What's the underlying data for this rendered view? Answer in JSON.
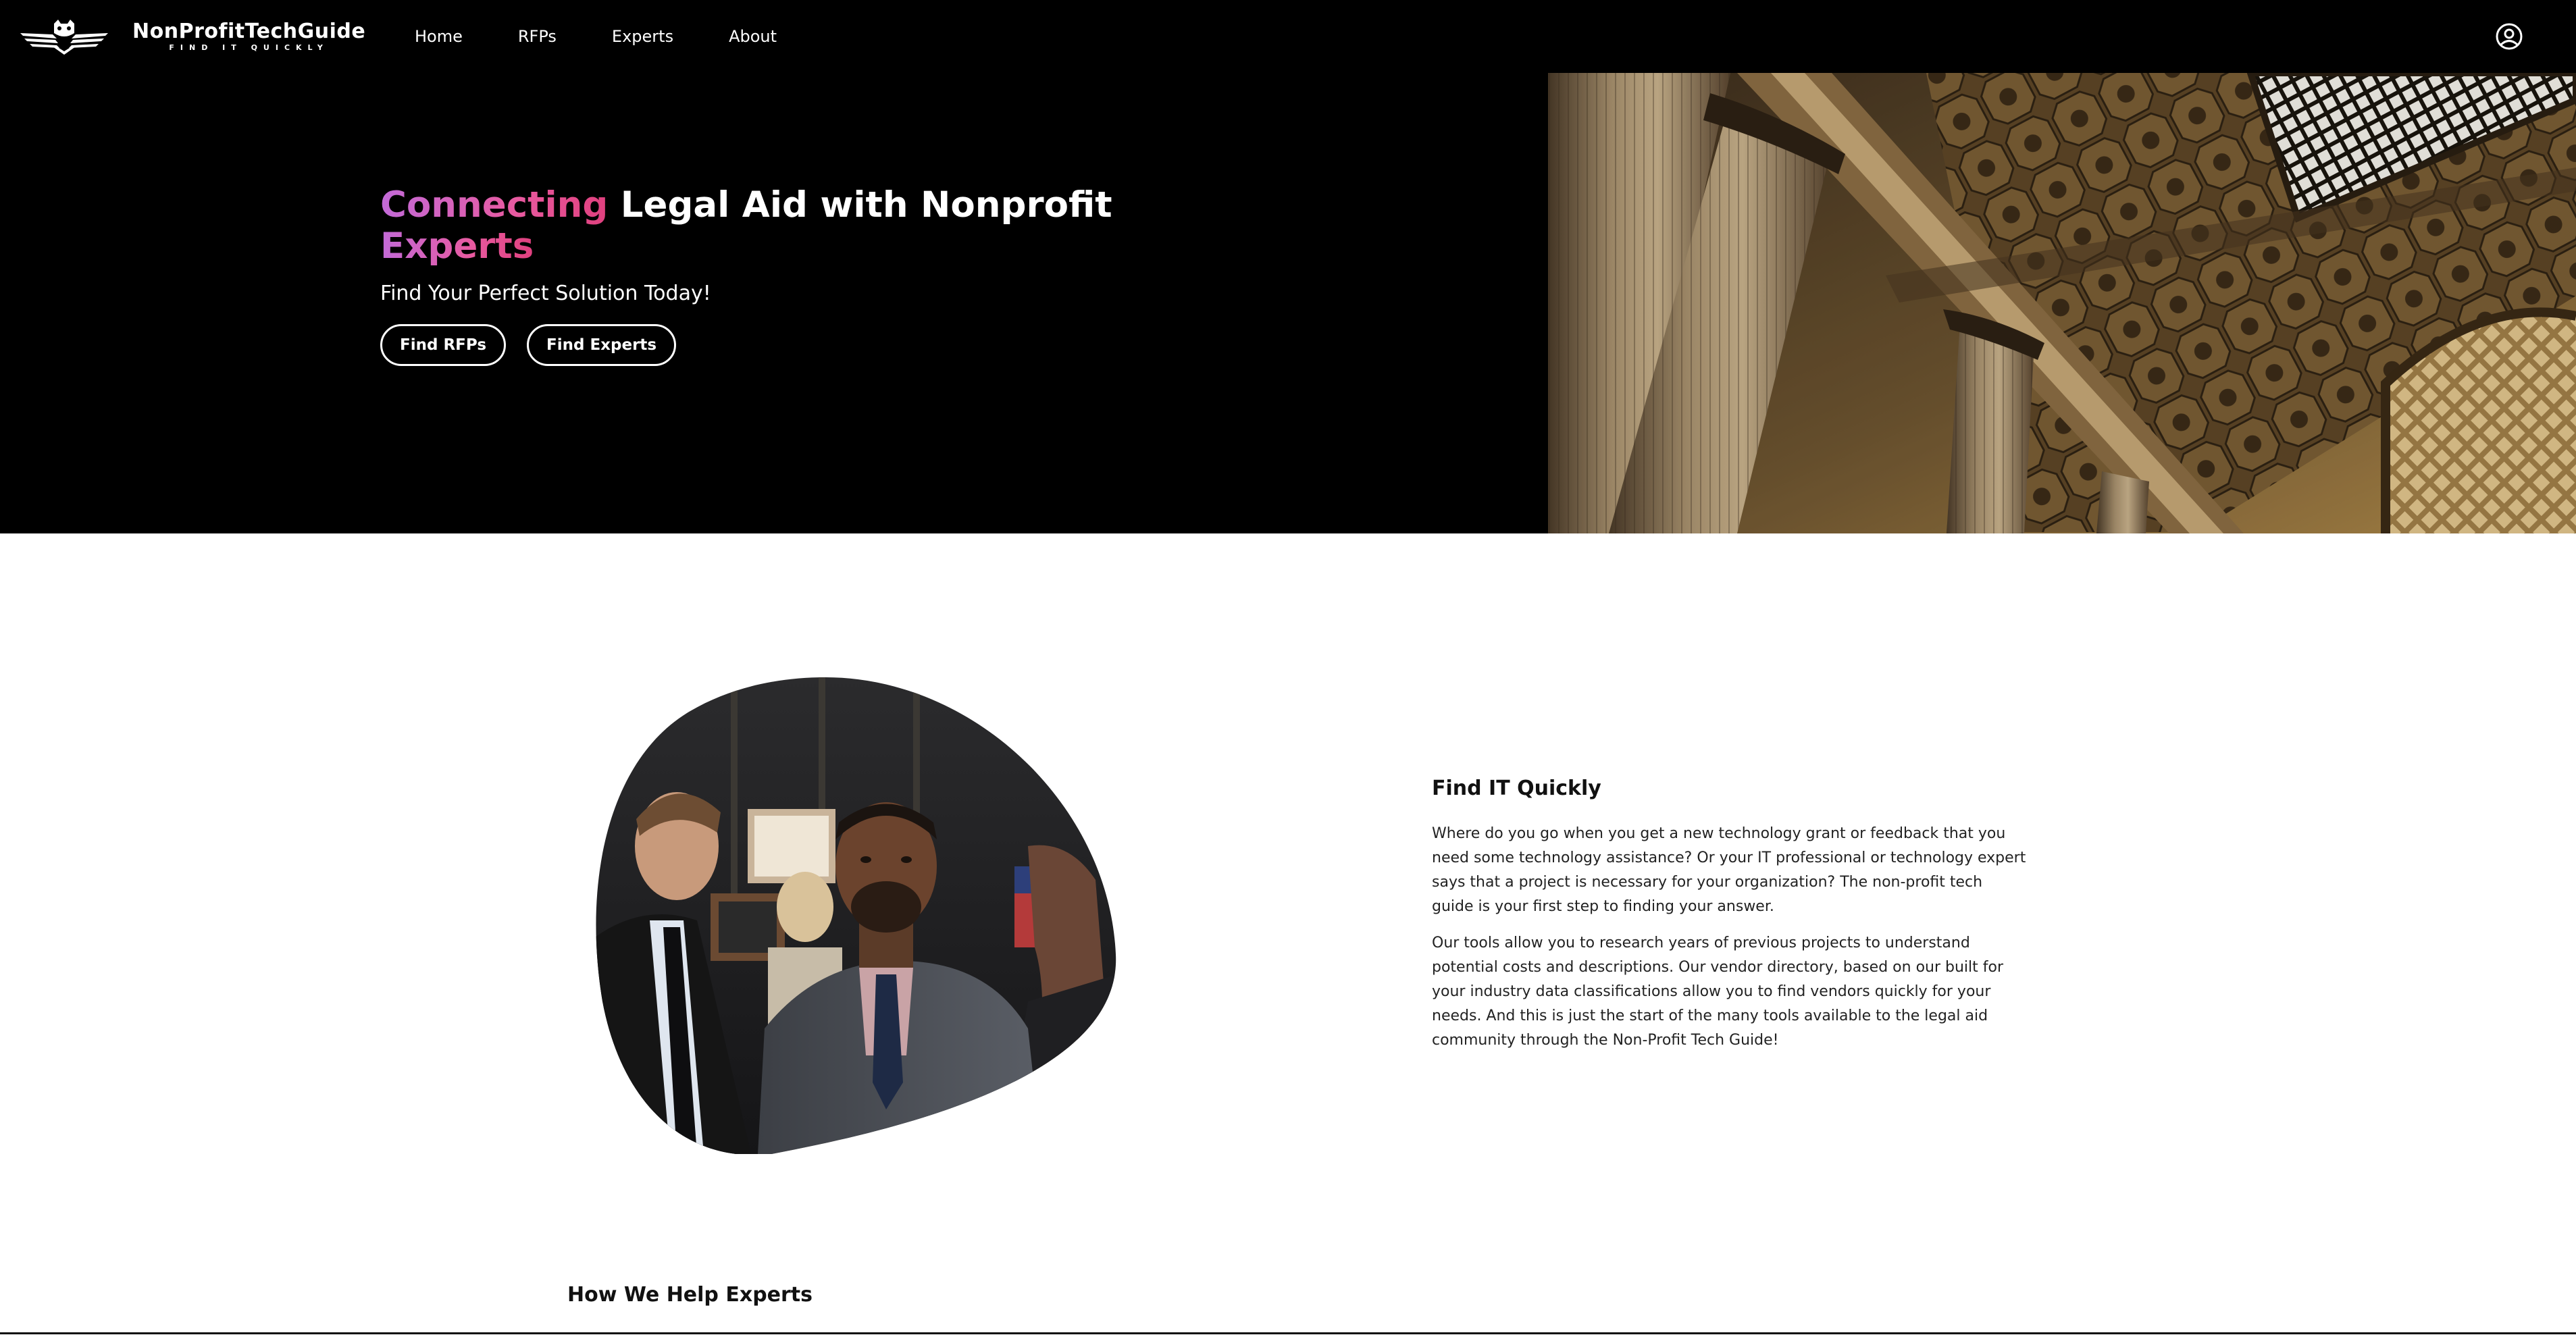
{
  "brand": {
    "name": "NonProfitTechGuide",
    "tagline": "FIND IT QUICKLY",
    "logo_icon": "owl-wings-logo-icon"
  },
  "nav": {
    "items": [
      {
        "label": "Home"
      },
      {
        "label": "RFPs"
      },
      {
        "label": "Experts"
      },
      {
        "label": "About"
      }
    ],
    "account_icon": "user-circle-icon"
  },
  "hero": {
    "title_highlight_1": "Connecting",
    "title_middle": " Legal Aid with Nonprofit ",
    "title_highlight_2": "Experts",
    "subtitle": "Find Your Perfect Solution Today!",
    "buttons": [
      {
        "label": "Find RFPs"
      },
      {
        "label": "Find Experts"
      }
    ],
    "image": "courthouse-columns-photo"
  },
  "feature": {
    "image": "professionals-meeting-photo",
    "title": "Find IT Quickly",
    "paragraphs": [
      "Where do you go when you get a new technology grant or feedback that you need some technology assistance? Or your IT professional or technology expert says that a project is necessary for your organization? The non-profit tech guide is your first step to finding your answer.",
      "Our tools allow you to research years of previous projects to understand potential costs and descriptions. Our vendor directory, based on our built for your industry data classifications allow you to find vendors quickly for your needs. And this is just the start of the many tools available to the legal aid community through the Non-Profit Tech Guide!"
    ]
  },
  "section2": {
    "title": "How We Help Experts"
  },
  "colors": {
    "nav_bg": "#000000",
    "hero_bg": "#000000",
    "gradient_start": "#c26ad8",
    "gradient_end": "#e0407e",
    "text_dark": "#111111"
  }
}
